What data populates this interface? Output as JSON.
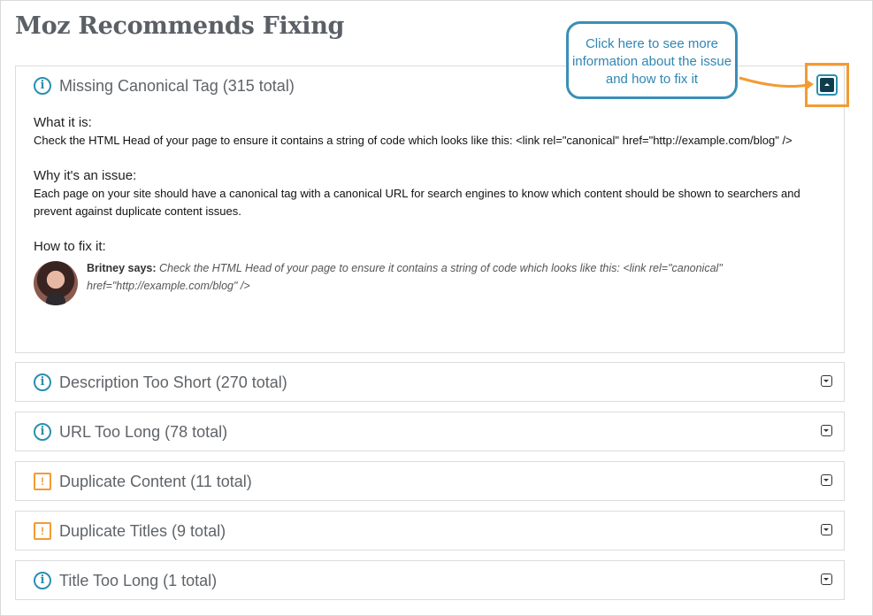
{
  "page": {
    "title": "Moz Recommends Fixing"
  },
  "callout": {
    "text": "Click here to see more information about the issue and how to fix it"
  },
  "expanded_issue": {
    "title": "Missing Canonical Tag (315 total)",
    "icon": "info-icon",
    "what_heading": "What it is:",
    "what_text": "Check the HTML Head of your page to ensure it contains a string of code which looks like this: <link rel=\"canonical\" href=\"http://example.com/blog\" />",
    "why_heading": "Why it's an issue:",
    "why_text": "Each page on your site should have a canonical tag with a canonical URL for search engines to know which content should be shown to searchers and prevent against duplicate content issues.",
    "how_heading": "How to fix it:",
    "expert_name": "Britney says:",
    "expert_text": "Check the HTML Head of your page to ensure it contains a string of code which looks like this: <link rel=\"canonical\" href=\"http://example.com/blog\" />"
  },
  "issues": [
    {
      "title": "Description Too Short (270 total)",
      "icon": "info-icon"
    },
    {
      "title": "URL Too Long (78 total)",
      "icon": "info-icon"
    },
    {
      "title": "Duplicate Content (11 total)",
      "icon": "warning-icon"
    },
    {
      "title": "Duplicate Titles (9 total)",
      "icon": "warning-icon"
    },
    {
      "title": "Title Too Long (1 total)",
      "icon": "info-icon"
    }
  ],
  "colors": {
    "info": "#2a8fb0",
    "warning": "#f29b33",
    "callout": "#3a8fb7",
    "title": "#5b6066"
  }
}
